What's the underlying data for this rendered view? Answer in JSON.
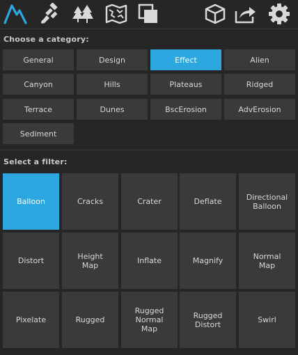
{
  "toolbar": {
    "left_icons": [
      "terrain-logo-icon",
      "paint-brush-icon",
      "trees-icon",
      "map-icon",
      "layers-icon"
    ],
    "right_icons": [
      "cube-export-icon",
      "share-icon",
      "gear-icon"
    ],
    "accent": "#2da7e0"
  },
  "category_section": {
    "label": "Choose a category:",
    "selected": "Effect",
    "categories": [
      "General",
      "Design",
      "Effect",
      "Alien",
      "Canyon",
      "Hills",
      "Plateaus",
      "Ridged",
      "Terrace",
      "Dunes",
      "BscErosion",
      "AdvErosion",
      "Sediment"
    ]
  },
  "filter_section": {
    "label": "Select a filter:",
    "selected": "Balloon",
    "filters": [
      "Balloon",
      "Cracks",
      "Crater",
      "Deflate",
      "Directional\nBalloon",
      "Distort",
      "Height\nMap",
      "Inflate",
      "Magnify",
      "Normal\nMap",
      "Pixelate",
      "Rugged",
      "Rugged\nNormal\nMap",
      "Rugged\nDistort",
      "Swirl"
    ]
  }
}
